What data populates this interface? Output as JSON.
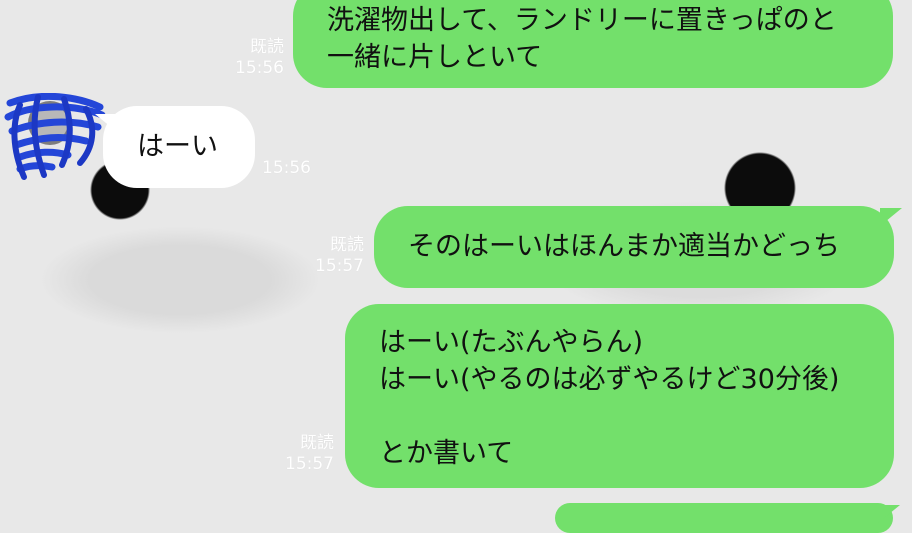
{
  "chat": {
    "messages": [
      {
        "type": "sent",
        "lines": [
          "洗濯物出して、ランドリーに置きっぱのと",
          "一緒に片しといて"
        ],
        "read_label": "既読",
        "time": "15:56"
      },
      {
        "type": "received",
        "lines": [
          "はーい"
        ],
        "time": "15:56"
      },
      {
        "type": "sent",
        "lines": [
          "そのはーいはほんまか適当かどっち"
        ],
        "read_label": "既読",
        "time": "15:57"
      },
      {
        "type": "sent",
        "lines": [
          "はーい(たぶんやらん)",
          "はーい(やるのは必ずやるけど30分後)",
          "",
          "とか書いて"
        ],
        "read_label": "既読",
        "time": "15:57"
      }
    ]
  }
}
